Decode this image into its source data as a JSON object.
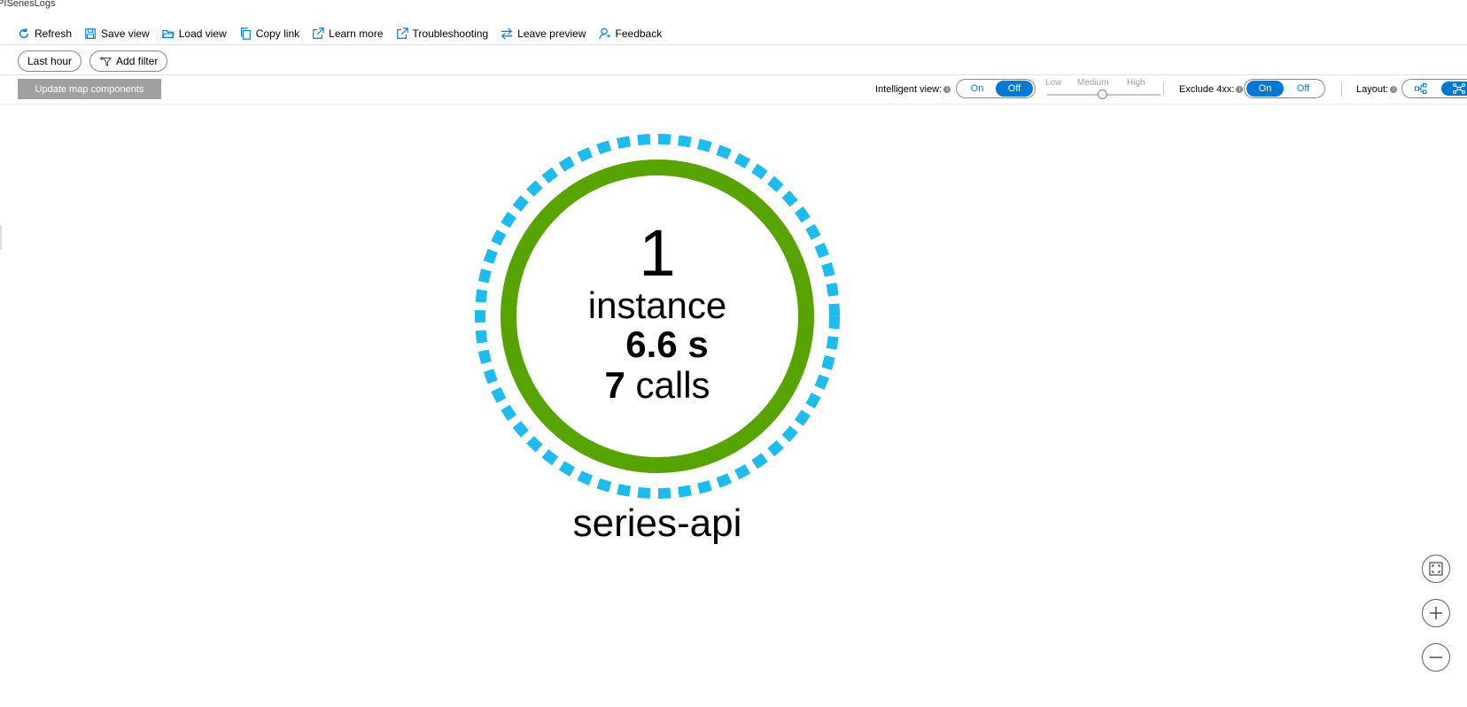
{
  "app": {
    "title": ".PISeriesLogs"
  },
  "toolbar": {
    "items": [
      {
        "label": "Refresh",
        "icon": "refresh-icon"
      },
      {
        "label": "Save view",
        "icon": "save-icon"
      },
      {
        "label": "Load view",
        "icon": "folder-open-icon"
      },
      {
        "label": "Copy link",
        "icon": "copy-icon"
      },
      {
        "label": "Learn more",
        "icon": "external-link-icon"
      },
      {
        "label": "Troubleshooting",
        "icon": "external-link-icon"
      },
      {
        "label": "Leave preview",
        "icon": "switch-arrows-icon"
      },
      {
        "label": "Feedback",
        "icon": "feedback-icon"
      }
    ]
  },
  "filters": {
    "time_range": "Last hour",
    "add_filter": "Add filter"
  },
  "controls": {
    "update_button": "Update map components",
    "intelligent_view": {
      "label": "Intelligent view:",
      "on": "On",
      "off": "Off",
      "selected": "Off"
    },
    "sensitivity": {
      "low": "Low",
      "medium": "Medium",
      "high": "High",
      "value": "Medium"
    },
    "exclude_4xx": {
      "label": "Exclude 4xx:",
      "on": "On",
      "off": "Off",
      "selected": "On"
    },
    "layout": {
      "label": "Layout:",
      "selected": "network"
    }
  },
  "node": {
    "instances": "1",
    "instances_label": "instance",
    "duration": "6.6 s",
    "calls_count": "7",
    "calls_label": "calls",
    "name": "series-api",
    "colors": {
      "ring": "#57a300",
      "dashed_ring": "#1ebbee"
    }
  },
  "zoom": {
    "fit": "fit-to-screen-icon",
    "in": "zoom-in-icon",
    "out": "zoom-out-icon"
  }
}
